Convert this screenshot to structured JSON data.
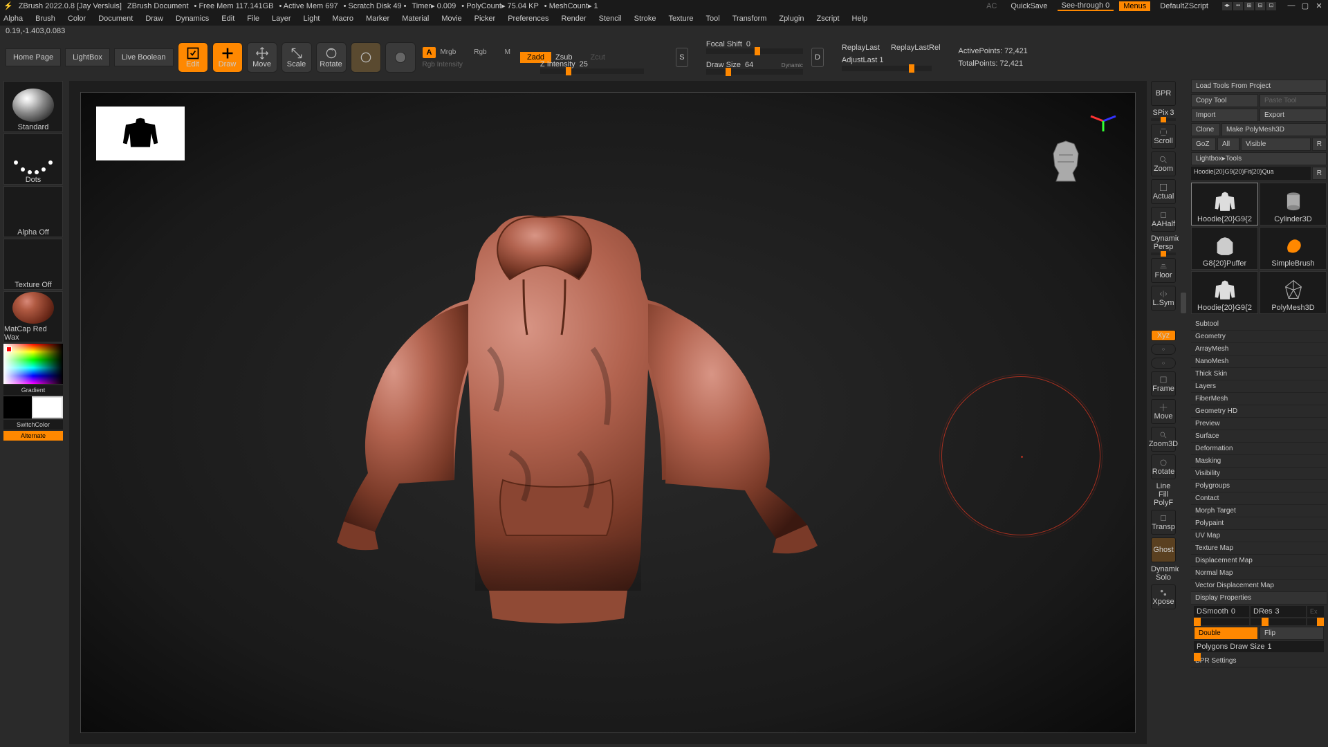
{
  "title": {
    "app": "ZBrush 2022.0.8 [Jay Versluis]",
    "doc": "ZBrush Document",
    "freemem": "• Free Mem 117.141GB",
    "activemem": "• Active Mem 697",
    "scratch": "• Scratch Disk 49 •",
    "timer": "Timer▸ 0.009",
    "polycount": "• PolyCount▸ 75.04 KP",
    "meshcount": "• MeshCount▸ 1",
    "ac": "AC",
    "quicksave": "QuickSave",
    "seethrough": "See-through  0",
    "menus": "Menus",
    "defaultscript": "DefaultZScript"
  },
  "menu": [
    "Alpha",
    "Brush",
    "Color",
    "Document",
    "Draw",
    "Dynamics",
    "Edit",
    "File",
    "Layer",
    "Light",
    "Macro",
    "Marker",
    "Material",
    "Movie",
    "Picker",
    "Preferences",
    "Render",
    "Stencil",
    "Stroke",
    "Texture",
    "Tool",
    "Transform",
    "Zplugin",
    "Zscript",
    "Help"
  ],
  "status": "0.19,-1.403,0.083",
  "shelf": {
    "home": "Home Page",
    "lightbox": "LightBox",
    "liveboolean": "Live Boolean",
    "edit": "Edit",
    "draw": "Draw",
    "move": "Move",
    "scale": "Scale",
    "rotate": "Rotate",
    "a": "A",
    "mrgb": "Mrgb",
    "rgb": "Rgb",
    "m": "M",
    "rgb_intensity_label": "Rgb Intensity",
    "zadd": "Zadd",
    "zsub": "Zsub",
    "zcut": "Zcut",
    "zintensity_label": "Z Intensity",
    "zintensity_val": "25",
    "s_label": "S",
    "focal_shift_label": "Focal Shift",
    "focal_shift_val": "0",
    "draw_size_label": "Draw Size",
    "draw_size_val": "64",
    "dynamic": "Dynamic",
    "d_label": "D",
    "replay_last": "ReplayLast",
    "replay_last_rel": "ReplayLastRel",
    "adjust_last": "AdjustLast",
    "adjust_last_val": "1",
    "active_points": "ActivePoints: 72,421",
    "total_points": "TotalPoints: 72,421"
  },
  "left": {
    "standard": "Standard",
    "dots": "Dots",
    "alpha_off": "Alpha Off",
    "texture_off": "Texture Off",
    "matcap": "MatCap Red Wax",
    "gradient": "Gradient",
    "switchcolor": "SwitchColor",
    "alternate": "Alternate"
  },
  "side": {
    "bpr": "BPR",
    "spix": "SPix",
    "spix_val": "3",
    "scroll": "Scroll",
    "zoom": "Zoom",
    "actual": "Actual",
    "aahalf": "AAHalf",
    "dynamic": "Dynamic",
    "persp": "Persp",
    "floor": "Floor",
    "lsym": "L.Sym",
    "xyz": "Xyz",
    "frame": "Frame",
    "move": "Move",
    "zoom3d": "Zoom3D",
    "rotate": "Rotate",
    "linefill": "Line Fill",
    "polyf": "PolyF",
    "transp": "Transp",
    "ghost": "Ghost",
    "dynamic2": "Dynamic",
    "solo": "Solo",
    "xpose": "Xpose"
  },
  "right": {
    "load": "Load Tools From Project",
    "copy": "Copy Tool",
    "paste": "Paste Tool",
    "import": "Import",
    "export": "Export",
    "clone": "Clone",
    "makepm": "Make PolyMesh3D",
    "goz": "GoZ",
    "all": "All",
    "visible": "Visible",
    "r": "R",
    "lightbox_tools": "Lightbox▸Tools",
    "current": "Hoodie{20}G9{20}Fit{20}Qua",
    "tools": [
      {
        "label": "Hoodie{20}G9{2"
      },
      {
        "label": "Cylinder3D"
      },
      {
        "label": "G8{20}Puffer"
      },
      {
        "label": "SimpleBrush"
      },
      {
        "label": "Hoodie{20}G9{2"
      },
      {
        "label": "PolyMesh3D"
      }
    ],
    "panels": [
      "Subtool",
      "Geometry",
      "ArrayMesh",
      "NanoMesh",
      "Thick Skin",
      "Layers",
      "FiberMesh",
      "Geometry HD",
      "Preview",
      "Surface",
      "Deformation",
      "Masking",
      "Visibility",
      "Polygroups",
      "Contact",
      "Morph Target",
      "Polypaint",
      "UV Map",
      "Texture Map",
      "Displacement Map",
      "Normal Map",
      "Vector Displacement Map"
    ],
    "display_properties": "Display Properties",
    "dsmooth": "DSmooth",
    "dsmooth_val": "0",
    "dres": "DRes",
    "dres_val": "3",
    "ex": "Ex",
    "double": "Double",
    "flip": "Flip",
    "poly_draw": "Polygons Draw Size",
    "poly_draw_val": "1",
    "bpr_settings": "BPR Settings"
  }
}
